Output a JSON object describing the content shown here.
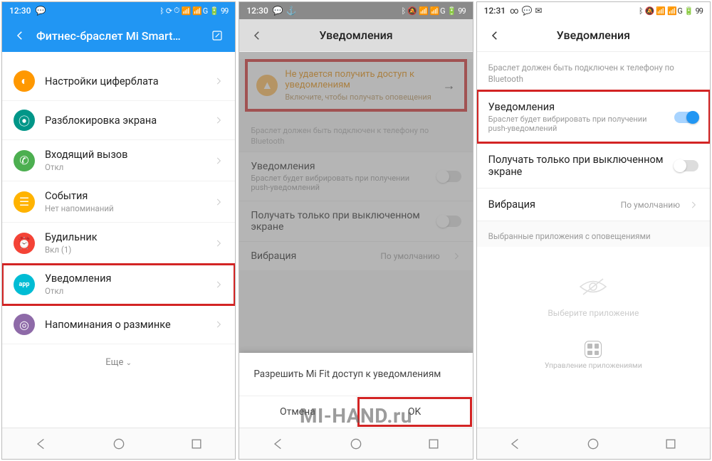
{
  "watermark": "MI-HAND.ru",
  "phone1": {
    "status": {
      "time": "12:30",
      "battery": "99"
    },
    "header": {
      "title": "Фитнес-браслет Mi Smart…"
    },
    "rows": [
      {
        "icon": "c-orange",
        "label": "Настройки циферблата",
        "sub": ""
      },
      {
        "icon": "c-teal",
        "label": "Разблокировка экрана",
        "sub": ""
      },
      {
        "icon": "c-green",
        "label": "Входящий вызов",
        "sub": "Откл"
      },
      {
        "icon": "c-amber",
        "label": "События",
        "sub": "Нет напоминаний"
      },
      {
        "icon": "c-red",
        "label": "Будильник",
        "sub": "Вкл (1)"
      },
      {
        "icon": "c-cyan",
        "label": "Уведомления",
        "sub": "Откл",
        "highlight": true,
        "badge": "app"
      },
      {
        "icon": "c-purple",
        "label": "Напоминания о разминке",
        "sub": ""
      }
    ],
    "more": "Еще"
  },
  "phone2": {
    "status": {
      "time": "12:30",
      "battery": "99"
    },
    "header": {
      "title": "Уведомления"
    },
    "banner": {
      "line1": "Не удается получить доступ к уведомлениям",
      "line2": "Включите, чтобы получать оповещения"
    },
    "note": "Браслет должен быть подключен к телефону по Bluetooth",
    "rows": {
      "notify_label": "Уведомления",
      "notify_sub": "Браслет будет вибрировать при получении push-уведомлений",
      "screen_off_label": "Получать только при выключенном экране",
      "vibration_label": "Вибрация",
      "vibration_value": "По умолчанию"
    },
    "dialog": {
      "message": "Разрешить Mi Fit доступ к уведомлениям",
      "cancel": "Отмена",
      "ok": "OK"
    }
  },
  "phone3": {
    "status": {
      "time": "12:31",
      "battery": "99"
    },
    "header": {
      "title": "Уведомления"
    },
    "note": "Браслет должен быть подключен к телефону по Bluetooth",
    "rows": {
      "notify_label": "Уведомления",
      "notify_sub": "Браслет будет вибрировать при получении push-уведомлений",
      "screen_off_label": "Получать только при выключенном экране",
      "vibration_label": "Вибрация",
      "vibration_value": "По умолчанию"
    },
    "section": "Выбранные приложения с оповещениями",
    "empty": "Выберите приложение",
    "app_manage": "Управление приложениями"
  }
}
